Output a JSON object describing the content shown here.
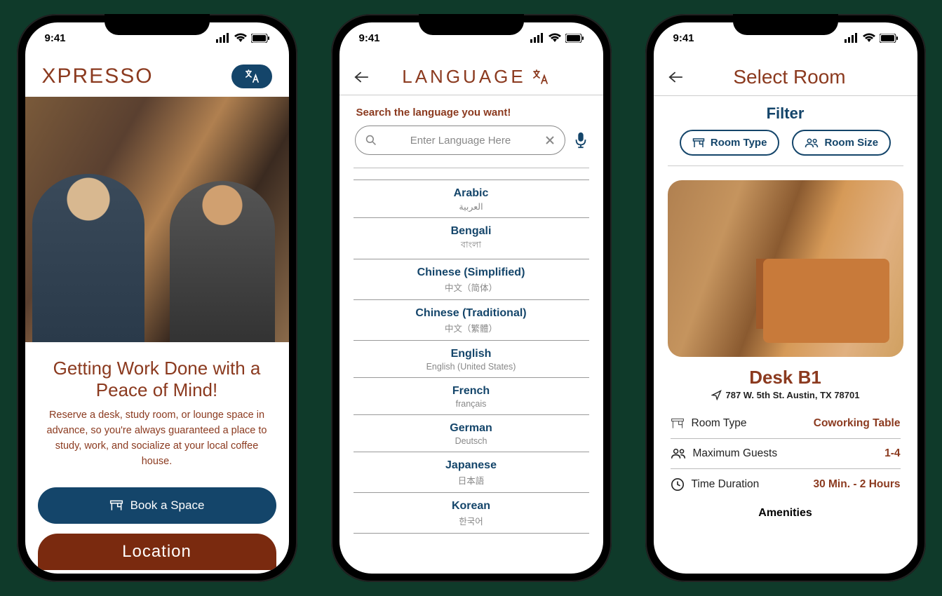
{
  "status": {
    "time": "9:41"
  },
  "phone1": {
    "brand": "XPRESSO",
    "tagline": "Getting Work Done with a Peace of Mind!",
    "subtext": "Reserve a desk, study room, or lounge space in advance, so you're always guaranteed a place to study, work, and socialize at your local coffee house.",
    "book_label": "Book a Space",
    "location_label": "Location"
  },
  "phone2": {
    "title": "LANGUAGE",
    "search_label": "Search the language you want!",
    "search_placeholder": "Enter Language Here",
    "languages": [
      {
        "en": "Arabic",
        "native": "العربية"
      },
      {
        "en": "Bengali",
        "native": "বাংলা"
      },
      {
        "en": "Chinese (Simplified)",
        "native": "中文（简体）"
      },
      {
        "en": "Chinese (Traditional)",
        "native": "中文（繁體）"
      },
      {
        "en": "English",
        "native": "English (United States)"
      },
      {
        "en": "French",
        "native": "français"
      },
      {
        "en": "German",
        "native": "Deutsch"
      },
      {
        "en": "Japanese",
        "native": "日本語"
      },
      {
        "en": "Korean",
        "native": "한국어"
      }
    ]
  },
  "phone3": {
    "title": "Select Room",
    "filter_label": "Filter",
    "chip_room_type": "Room Type",
    "chip_room_size": "Room Size",
    "room_name": "Desk B1",
    "address": "787 W. 5th St. Austin, TX 78701",
    "specs": {
      "room_type_label": "Room Type",
      "room_type_value": "Coworking Table",
      "max_guests_label": "Maximum Guests",
      "max_guests_value": "1-4",
      "duration_label": "Time Duration",
      "duration_value": "30 Min. - 2 Hours"
    },
    "amenities_label": "Amenities"
  }
}
